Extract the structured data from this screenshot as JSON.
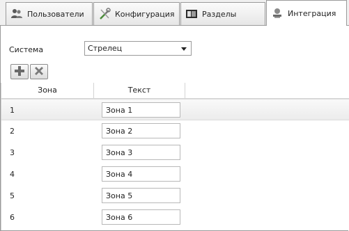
{
  "tabs": [
    {
      "label": "Пользователи",
      "icon": "users-icon",
      "active": false
    },
    {
      "label": "Конфигурация",
      "icon": "wrench-icon",
      "active": false
    },
    {
      "label": "Разделы",
      "icon": "sections-icon",
      "active": false
    },
    {
      "label": "Интеграция",
      "icon": "integration-icon",
      "active": true
    }
  ],
  "system": {
    "label": "Система",
    "selected": "Стрелец"
  },
  "toolbar": {
    "add_icon": "add-icon",
    "delete_icon": "delete-icon"
  },
  "grid": {
    "columns": [
      "Зона",
      "Текст"
    ],
    "rows": [
      {
        "zone": "1",
        "text": "Зона 1"
      },
      {
        "zone": "2",
        "text": "Зона 2"
      },
      {
        "zone": "3",
        "text": "Зона 3"
      },
      {
        "zone": "4",
        "text": "Зона 4"
      },
      {
        "zone": "5",
        "text": "Зона 5"
      },
      {
        "zone": "6",
        "text": "Зона 6"
      }
    ],
    "selected_row": 0
  }
}
